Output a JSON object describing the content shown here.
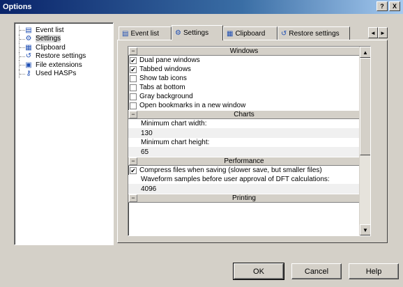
{
  "window": {
    "title": "Options",
    "help_button": "?",
    "close_button": "X"
  },
  "tree": {
    "items": [
      {
        "label": "Event list",
        "icon": "list-icon"
      },
      {
        "label": "Settings",
        "icon": "settings-icon",
        "selected": true
      },
      {
        "label": "Clipboard",
        "icon": "clipboard-icon"
      },
      {
        "label": "Restore settings",
        "icon": "restore-icon"
      },
      {
        "label": "File extensions",
        "icon": "file-icon"
      },
      {
        "label": "Used HASPs",
        "icon": "key-icon"
      }
    ]
  },
  "tabs": [
    {
      "label": "Event list",
      "icon": "list-icon"
    },
    {
      "label": "Settings",
      "icon": "settings-icon",
      "active": true
    },
    {
      "label": "Clipboard",
      "icon": "clipboard-icon"
    },
    {
      "label": "Restore settings",
      "icon": "restore-icon"
    }
  ],
  "tab_scroll": {
    "left": "◄",
    "right": "►"
  },
  "grid": {
    "windows": {
      "title": "Windows",
      "options": [
        {
          "label": "Dual pane windows",
          "checked": true
        },
        {
          "label": "Tabbed windows",
          "checked": true
        },
        {
          "label": "Show tab icons",
          "checked": false
        },
        {
          "label": "Tabs at bottom",
          "checked": false
        },
        {
          "label": "Gray background",
          "checked": false
        },
        {
          "label": "Open bookmarks in a new window",
          "checked": false
        }
      ]
    },
    "charts": {
      "title": "Charts",
      "min_width_label": "Minimum chart width:",
      "min_width_value": "130",
      "min_height_label": "Minimum chart height:",
      "min_height_value": "65"
    },
    "performance": {
      "title": "Performance",
      "compress_label": "Compress files when saving (slower save, but smaller files)",
      "compress_checked": true,
      "waveform_label": "Waveform samples before user approval of DFT calculations:",
      "waveform_value": "4096"
    },
    "printing": {
      "title": "Printing"
    }
  },
  "buttons": {
    "ok": "OK",
    "cancel": "Cancel",
    "help": "Help"
  }
}
